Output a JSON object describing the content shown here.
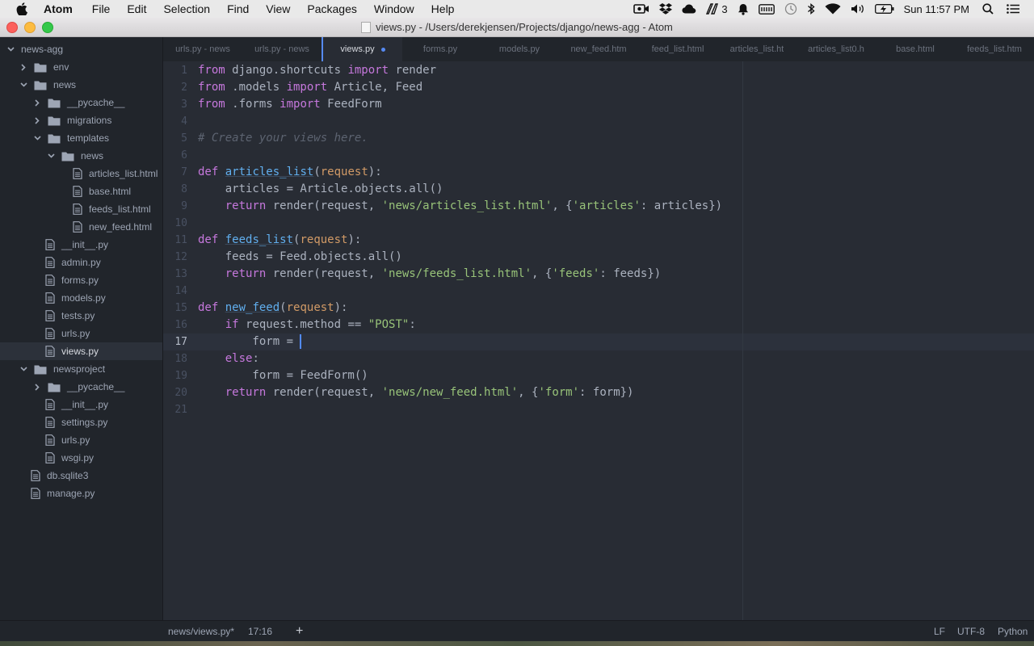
{
  "menubar": {
    "app_name": "Atom",
    "items": [
      "File",
      "Edit",
      "Selection",
      "Find",
      "View",
      "Packages",
      "Window",
      "Help"
    ],
    "adobe_badge": "3",
    "clock": "Sun 11:57 PM"
  },
  "window": {
    "title": "views.py - /Users/derekjensen/Projects/django/news-agg - Atom"
  },
  "tree": {
    "rows": [
      {
        "label": "news-agg",
        "type": "root"
      },
      {
        "label": "env",
        "type": "folder",
        "expanded": false
      },
      {
        "label": "news",
        "type": "folder",
        "expanded": true
      },
      {
        "label": "__pycache__",
        "type": "folder",
        "expanded": false
      },
      {
        "label": "migrations",
        "type": "folder",
        "expanded": false
      },
      {
        "label": "templates",
        "type": "folder",
        "expanded": true
      },
      {
        "label": "news",
        "type": "folder",
        "expanded": true
      },
      {
        "label": "articles_list.html",
        "type": "file"
      },
      {
        "label": "base.html",
        "type": "file"
      },
      {
        "label": "feeds_list.html",
        "type": "file"
      },
      {
        "label": "new_feed.html",
        "type": "file"
      },
      {
        "label": "__init__.py",
        "type": "file"
      },
      {
        "label": "admin.py",
        "type": "file"
      },
      {
        "label": "forms.py",
        "type": "file"
      },
      {
        "label": "models.py",
        "type": "file"
      },
      {
        "label": "tests.py",
        "type": "file"
      },
      {
        "label": "urls.py",
        "type": "file"
      },
      {
        "label": "views.py",
        "type": "file",
        "selected": true
      },
      {
        "label": "newsproject",
        "type": "folder",
        "expanded": true
      },
      {
        "label": "__pycache__",
        "type": "folder",
        "expanded": false
      },
      {
        "label": "__init__.py",
        "type": "file"
      },
      {
        "label": "settings.py",
        "type": "file"
      },
      {
        "label": "urls.py",
        "type": "file"
      },
      {
        "label": "wsgi.py",
        "type": "file"
      },
      {
        "label": "db.sqlite3",
        "type": "file"
      },
      {
        "label": "manage.py",
        "type": "file"
      }
    ]
  },
  "tabs": [
    {
      "label": "urls.py - news"
    },
    {
      "label": "urls.py - news"
    },
    {
      "label": "views.py",
      "active": true,
      "modified": true
    },
    {
      "label": "forms.py"
    },
    {
      "label": "models.py"
    },
    {
      "label": "new_feed.htm"
    },
    {
      "label": "feed_list.html"
    },
    {
      "label": "articles_list.ht"
    },
    {
      "label": "articles_list0.h"
    },
    {
      "label": "base.html"
    },
    {
      "label": "feeds_list.htm"
    }
  ],
  "editor": {
    "language": "Python",
    "current_line": 17,
    "line_numbers": [
      "1",
      "2",
      "3",
      "4",
      "5",
      "6",
      "7",
      "8",
      "9",
      "10",
      "11",
      "12",
      "13",
      "14",
      "15",
      "16",
      "17",
      "18",
      "19",
      "20",
      "21"
    ],
    "lines": [
      "from django.shortcuts import render",
      "from .models import Article, Feed",
      "from .forms import FeedForm",
      "",
      "# Create your views here.",
      "",
      "def articles_list(request):",
      "    articles = Article.objects.all()",
      "    return render(request, 'news/articles_list.html', {'articles': articles})",
      "",
      "def feeds_list(request):",
      "    feeds = Feed.objects.all()",
      "    return render(request, 'news/feeds_list.html', {'feeds': feeds})",
      "",
      "def new_feed(request):",
      "    if request.method == \"POST\":",
      "        form = ",
      "    else:",
      "        form = FeedForm()",
      "    return render(request, 'news/new_feed.html', {'form': form})",
      ""
    ]
  },
  "statusbar": {
    "file_path": "news/views.py*",
    "cursor_position": "17:16",
    "add_label": "+",
    "line_ending": "LF",
    "encoding": "UTF-8",
    "grammar": "Python"
  },
  "colors": {
    "accent": "#568af2",
    "keyword": "#c678dd",
    "function": "#61afef",
    "string": "#98c379",
    "comment": "#5c6370",
    "parameter": "#d19a66"
  }
}
